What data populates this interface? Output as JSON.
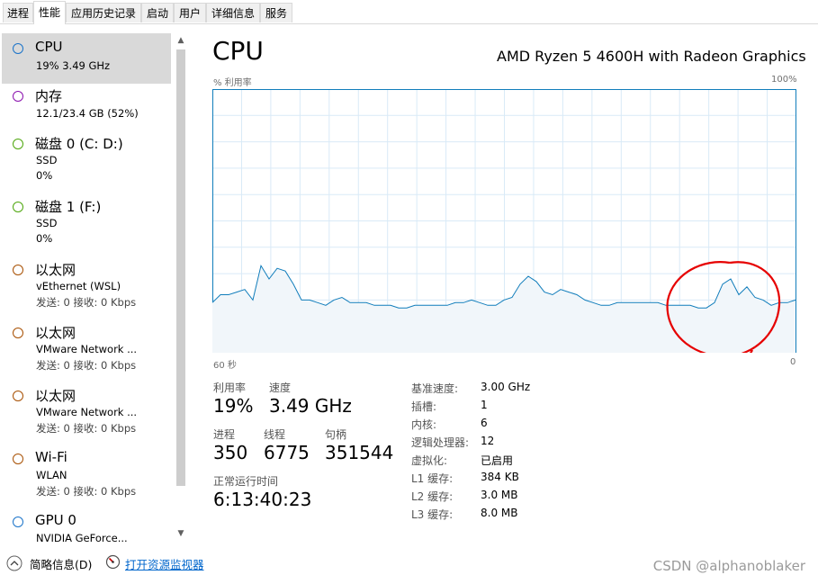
{
  "tabs": [
    {
      "label": "进程"
    },
    {
      "label": "性能"
    },
    {
      "label": "应用历史记录"
    },
    {
      "label": "启动"
    },
    {
      "label": "用户"
    },
    {
      "label": "详细信息"
    },
    {
      "label": "服务"
    }
  ],
  "active_tab": "性能",
  "sidebar": {
    "items": [
      {
        "title": "CPU",
        "lines": [
          "19% 3.49 GHz"
        ],
        "color": "#1a73c9",
        "selected": true
      },
      {
        "title": "内存",
        "lines": [
          "12.1/23.4 GB (52%)"
        ],
        "color": "#8b12ae"
      },
      {
        "title": "磁盘 0 (C: D:)",
        "lines": [
          "SSD",
          "0%"
        ],
        "color": "#4da60c"
      },
      {
        "title": "磁盘 1 (F:)",
        "lines": [
          "SSD",
          "0%"
        ],
        "color": "#4da60c"
      },
      {
        "title": "以太网",
        "lines": [
          "vEthernet (WSL)",
          "发送: 0 接收: 0 Kbps"
        ],
        "color": "#a74f01"
      },
      {
        "title": "以太网",
        "lines": [
          "VMware Network ...",
          "发送: 0 接收: 0 Kbps"
        ],
        "color": "#a74f01"
      },
      {
        "title": "以太网",
        "lines": [
          "VMware Network ...",
          "发送: 0 接收: 0 Kbps"
        ],
        "color": "#a74f01"
      },
      {
        "title": "Wi-Fi",
        "lines": [
          "WLAN",
          "发送: 0 接收: 0 Kbps"
        ],
        "color": "#a74f01"
      },
      {
        "title": "GPU 0",
        "lines": [
          "NVIDIA GeForce..."
        ],
        "color": "#1a73c9"
      }
    ]
  },
  "main": {
    "title": "CPU",
    "model": "AMD Ryzen 5 4600H with Radeon Graphics",
    "graph": {
      "y_label": "% 利用率",
      "y_max_label": "100%",
      "x_left_label": "60 秒",
      "x_right_label": "0",
      "grid_color": "#d9eaf7",
      "line_color": "#117dbb",
      "fill_color": "#f1f6fa",
      "annotation_color": "#e60000",
      "samples": [
        19,
        22,
        22,
        23,
        24,
        20,
        33,
        28,
        32,
        31,
        26,
        20,
        20,
        19,
        18,
        20,
        21,
        19,
        19,
        19,
        18,
        18,
        18,
        17,
        17,
        18,
        18,
        18,
        18,
        18,
        19,
        19,
        20,
        19,
        18,
        18,
        20,
        21,
        26,
        29,
        27,
        23,
        22,
        24,
        23,
        22,
        20,
        19,
        18,
        18,
        19,
        19,
        19,
        19,
        19,
        19,
        18,
        18,
        18,
        18,
        17,
        17,
        19,
        26,
        28,
        22,
        25,
        21,
        20,
        18,
        19,
        19,
        20
      ]
    },
    "stats": {
      "utilization": {
        "label": "利用率",
        "value": "19%"
      },
      "speed": {
        "label": "速度",
        "value": "3.49 GHz"
      },
      "processes": {
        "label": "进程",
        "value": "350"
      },
      "threads": {
        "label": "线程",
        "value": "6775"
      },
      "handles": {
        "label": "句柄",
        "value": "351544"
      },
      "uptime": {
        "label": "正常运行时间",
        "value": "6:13:40:23"
      }
    },
    "specs": [
      {
        "label": "基准速度:",
        "value": "3.00 GHz"
      },
      {
        "label": "插槽:",
        "value": "1"
      },
      {
        "label": "内核:",
        "value": "6"
      },
      {
        "label": "逻辑处理器:",
        "value": "12"
      },
      {
        "label": "虚拟化:",
        "value": "已启用"
      },
      {
        "label": "L1 缓存:",
        "value": "384 KB"
      },
      {
        "label": "L2 缓存:",
        "value": "3.0 MB"
      },
      {
        "label": "L3 缓存:",
        "value": "8.0 MB"
      }
    ]
  },
  "footer": {
    "summary_label": "简略信息(D)",
    "monitor_link": "打开资源监视器"
  },
  "watermark": "CSDN @alphanoblaker"
}
